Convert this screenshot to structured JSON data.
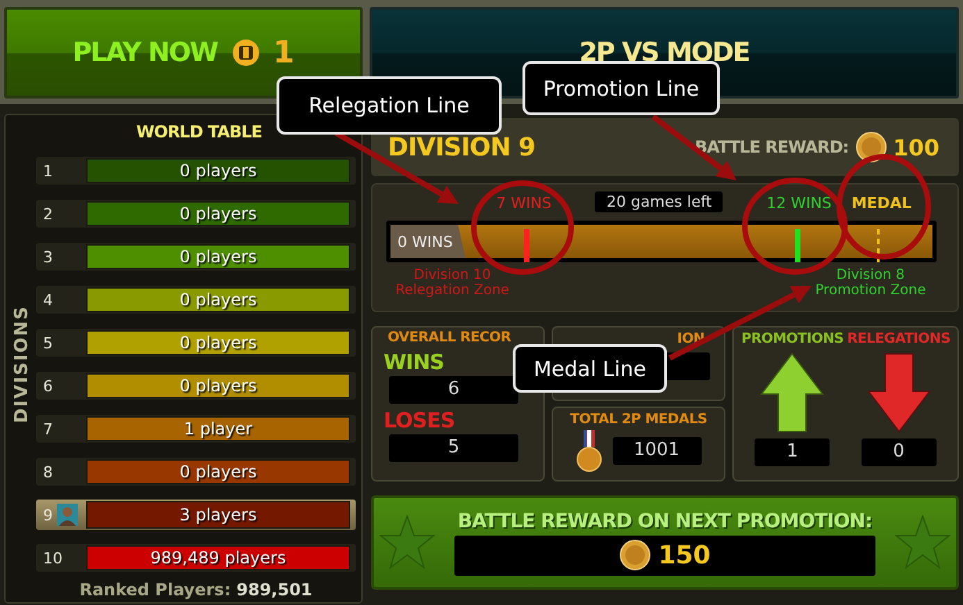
{
  "play_button": {
    "label": "PLAY NOW",
    "tickets": "1"
  },
  "mode_button": {
    "label": "2P VS MODE"
  },
  "world_table": {
    "title": "WORLD TABLE",
    "side_label": "DIVISIONS",
    "divisions": [
      {
        "number": "1",
        "players": "0 players",
        "color": "#245200",
        "selected": false
      },
      {
        "number": "2",
        "players": "0 players",
        "color": "#2f6a00",
        "selected": false
      },
      {
        "number": "3",
        "players": "0 players",
        "color": "#4e8f00",
        "selected": false
      },
      {
        "number": "4",
        "players": "0 players",
        "color": "#889a00",
        "selected": false
      },
      {
        "number": "5",
        "players": "0 players",
        "color": "#b0a000",
        "selected": false
      },
      {
        "number": "6",
        "players": "0 players",
        "color": "#b08e00",
        "selected": false
      },
      {
        "number": "7",
        "players": "1 player",
        "color": "#a86400",
        "selected": false
      },
      {
        "number": "8",
        "players": "0 players",
        "color": "#983800",
        "selected": false
      },
      {
        "number": "9",
        "players": "3 players",
        "color": "#741800",
        "selected": true
      },
      {
        "number": "10",
        "players": "989,489 players",
        "color": "#cc0000",
        "selected": false
      }
    ],
    "ranked_label": "Ranked Players:",
    "ranked_value": "989,501"
  },
  "division": {
    "title": "DIVISION 9",
    "reward_label": "BATTLE REWARD:",
    "reward_value": "100"
  },
  "progress": {
    "start_label": "0 WINS",
    "games_left": "20 games left",
    "markers": [
      {
        "kind": "relegation",
        "label": "7 WINS"
      },
      {
        "kind": "promotion",
        "label": "12 WINS"
      },
      {
        "kind": "medal",
        "label": "MEDAL"
      }
    ],
    "zones": [
      {
        "kind": "relegation",
        "lines": [
          "Division 10",
          "Relegation Zone"
        ]
      },
      {
        "kind": "promotion",
        "lines": [
          "Division 8",
          "Promotion Zone"
        ]
      }
    ]
  },
  "record": {
    "title": "OVERALL RECOR",
    "wins_label": "WINS",
    "wins": "6",
    "loses_label": "LOSES",
    "loses": "5"
  },
  "hidden_box": {
    "title": "ION"
  },
  "medals": {
    "title": "TOTAL 2P MEDALS",
    "value": "1001"
  },
  "moves": {
    "promotions_label": "PROMOTIONS",
    "promotions": "1",
    "relegations_label": "RELEGATIONS",
    "relegations": "0"
  },
  "next_reward": {
    "title": "BATTLE REWARD ON NEXT PROMOTION:",
    "value": "150"
  },
  "callouts": [
    {
      "text": "Relegation Line"
    },
    {
      "text": "Promotion Line"
    },
    {
      "text": "Medal Line"
    }
  ]
}
